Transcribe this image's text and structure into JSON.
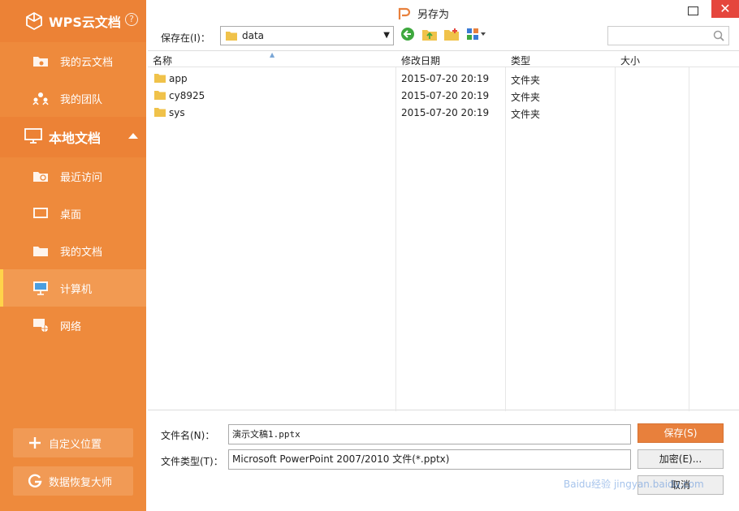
{
  "sidebar": {
    "brand": "WPS云文档",
    "help": "?",
    "cloud_items": [
      "我的云文档",
      "我的团队"
    ],
    "local_section": "本地文档",
    "local_items": [
      "最近访问",
      "桌面",
      "我的文档",
      "计算机",
      "网络"
    ],
    "active_item": "计算机",
    "custom_location_button": "自定义位置",
    "recovery_button": "数据恢复大师"
  },
  "dialog": {
    "title": "另存为",
    "close": "✕",
    "save_in_label": "保存在(I)：",
    "save_in_value": "data",
    "columns": [
      "名称",
      "修改日期",
      "类型",
      "大小"
    ],
    "files": [
      {
        "name": "app",
        "modified": "2015-07-20 20:19",
        "type": "文件夹",
        "size": ""
      },
      {
        "name": "cy8925",
        "modified": "2015-07-20 20:19",
        "type": "文件夹",
        "size": ""
      },
      {
        "name": "sys",
        "modified": "2015-07-20 20:19",
        "type": "文件夹",
        "size": ""
      }
    ],
    "filename_label": "文件名(N)：",
    "filename_value": "演示文稿1.pptx",
    "filetype_label": "文件类型(T)：",
    "filetype_value": "Microsoft PowerPoint 2007/2010 文件(*.pptx)",
    "save_button": "保存(S)",
    "encrypt_button": "加密(E)...",
    "cancel_button": "取消"
  },
  "watermark": "Baidu经验  jingyan.baidu.com",
  "colors": {
    "sidebar": "#ee8a3c",
    "accent": "#e8803c",
    "close": "#e5463d"
  }
}
